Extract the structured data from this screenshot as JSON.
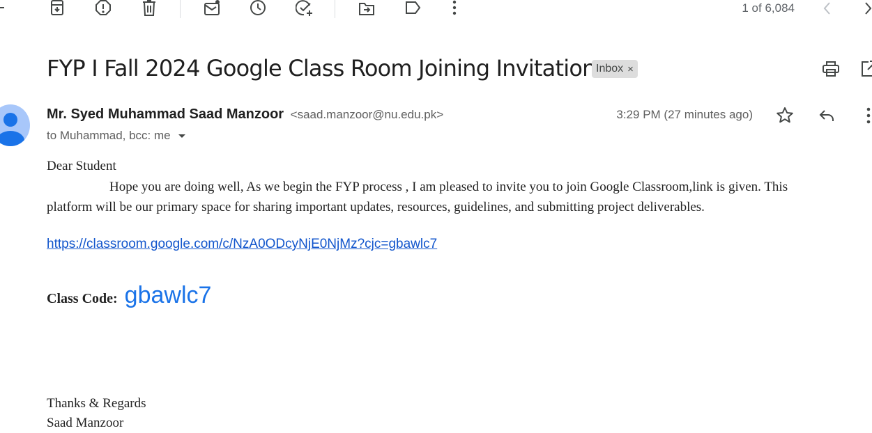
{
  "toolbar": {
    "buttons": [
      {
        "name": "archive"
      },
      {
        "name": "report-spam"
      },
      {
        "name": "delete"
      },
      {
        "name": "mark-unread"
      },
      {
        "name": "snooze"
      },
      {
        "name": "add-to-tasks"
      },
      {
        "name": "move-to"
      },
      {
        "name": "labels"
      },
      {
        "name": "more"
      }
    ],
    "pager": "1 of 6,084"
  },
  "email": {
    "subject": "FYP I Fall 2024 Google Class Room Joining Invitation",
    "label": "Inbox",
    "label_remove": "×",
    "sender_name": "Mr. Syed Muhammad Saad Manzoor",
    "sender_email": "<saad.manzoor@nu.edu.pk>",
    "recipients": "to Muhammad, bcc: me",
    "time": "3:29 PM (27 minutes ago)",
    "body": {
      "greeting": "Dear Student",
      "paragraph_first": "Hope you are doing well, As we begin the FYP process , I am pleased to invite you to join Google Classroom,link is given. This",
      "paragraph_rest": "platform will be our primary space for sharing important updates, resources, guidelines, and submitting project deliverables.",
      "link": "https://classroom.google.com/c/NzA0ODcyNjE0NjMz?cjc=gbawlc7",
      "code_label": "Class Code:",
      "code_value": "gbawlc7",
      "closing": "Thanks & Regards",
      "signature": "Saad Manzoor"
    }
  },
  "colors": {
    "link": "#1155cc",
    "code": "#1a73e8",
    "icon": "#444746",
    "avatar_bg": "#a8c7fa",
    "avatar_fg": "#1a73e8"
  }
}
